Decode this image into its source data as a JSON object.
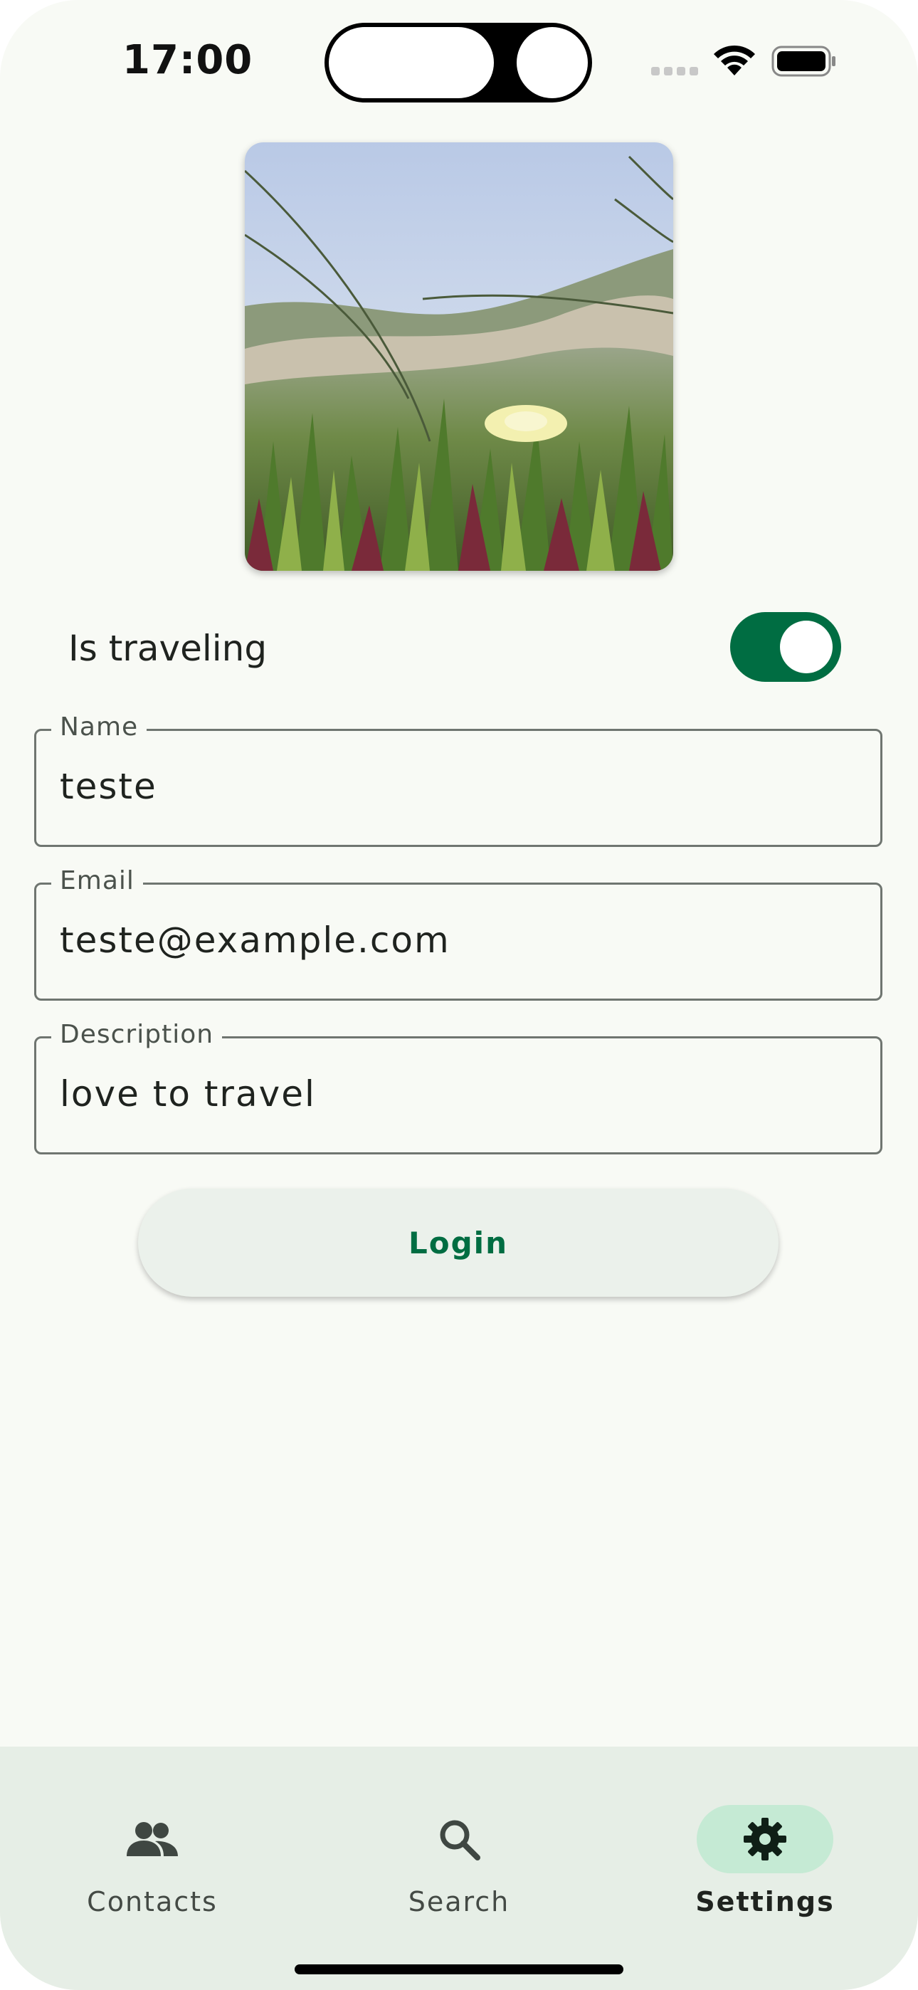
{
  "status_bar": {
    "time": "17:00"
  },
  "profile": {
    "photo_description": "photo-ice-plant-flower"
  },
  "traveling_toggle": {
    "label": "Is traveling",
    "on": true
  },
  "form": {
    "name": {
      "label": "Name",
      "value": "teste"
    },
    "email": {
      "label": "Email",
      "value": "teste@example.com"
    },
    "description": {
      "label": "Description",
      "value": "love to travel"
    }
  },
  "login_button": {
    "label": "Login"
  },
  "bottom_nav": {
    "items": [
      {
        "label": "Contacts",
        "icon": "people-icon",
        "active": false
      },
      {
        "label": "Search",
        "icon": "search-icon",
        "active": false
      },
      {
        "label": "Settings",
        "icon": "gear-icon",
        "active": true
      }
    ]
  },
  "colors": {
    "accent": "#006d42",
    "background": "#f8faf5",
    "nav_background": "#e6eee6",
    "nav_active_pill": "#c5ead4"
  }
}
